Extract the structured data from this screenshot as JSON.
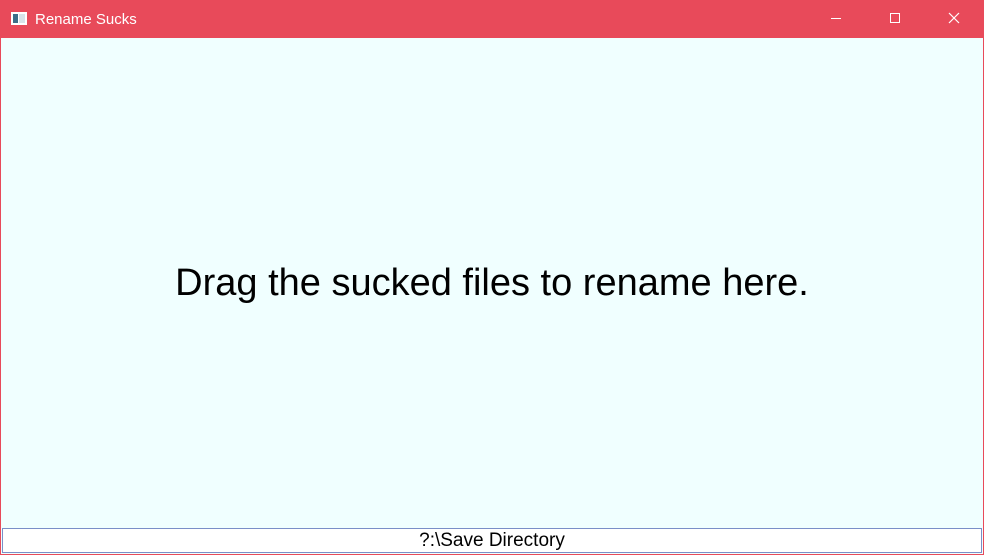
{
  "window": {
    "title": "Rename Sucks",
    "app_icon": "window-app-icon",
    "accent_color": "#e84a5a",
    "background_color": "#f0ffff",
    "controls": {
      "minimize_icon": "minimize-icon",
      "maximize_icon": "maximize-icon",
      "close_icon": "close-icon"
    }
  },
  "main": {
    "drop_message": "Drag the sucked files to rename here."
  },
  "footer": {
    "save_directory_value": "?:\\Save Directory"
  }
}
